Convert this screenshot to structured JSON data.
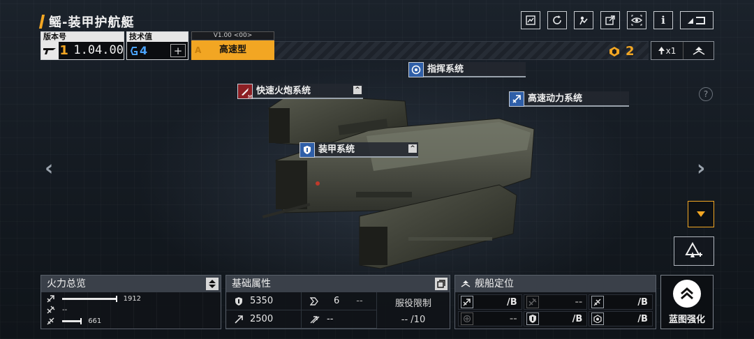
{
  "header": {
    "title": "鳐-装甲护航艇",
    "version": {
      "label": "版本号",
      "tier": "1",
      "value": "1.04.00"
    },
    "tech": {
      "label": "技术值",
      "value": "4",
      "add_symbol": "+"
    },
    "type": {
      "version_tag": "V1.00 <00>",
      "grade": "A",
      "value": "高速型"
    },
    "currency": {
      "value": "2"
    },
    "multiplier": {
      "value": "x1"
    },
    "toolbar_icons": [
      "blueprint-icon",
      "refresh-icon",
      "customize-icon",
      "share-icon",
      "view-icon",
      "info-icon",
      "return-icon"
    ],
    "info_label": "i"
  },
  "systems": [
    {
      "id": "cannon",
      "label": "快速火炮系统",
      "badge": "M",
      "collapse": "^"
    },
    {
      "id": "command",
      "label": "指挥系统"
    },
    {
      "id": "power",
      "label": "高速动力系统"
    },
    {
      "id": "armor",
      "label": "装甲系统",
      "collapse": "^"
    }
  ],
  "nav": {
    "prev": "‹",
    "next": "›",
    "help": "?"
  },
  "panels": {
    "firepower": {
      "title": "火力总览",
      "rows": [
        {
          "icon": "anti-ship-icon",
          "value": "1912",
          "fraction": 0.97
        },
        {
          "icon": "anti-air-icon",
          "value": "--",
          "fraction": 0
        },
        {
          "icon": "siege-icon",
          "value": "661",
          "fraction": 0.34
        }
      ]
    },
    "base": {
      "title": "基础属性",
      "hp": "5350",
      "armor": "6",
      "armor_extra": "--",
      "speed": "2500",
      "evasion": "--",
      "limit_label": "服役限制",
      "limit_value": "-- /10"
    },
    "position": {
      "title": "舰船定位",
      "cells": [
        {
          "icon": "anti-ship-icon",
          "value": "/B",
          "dim": false
        },
        {
          "icon": "anti-air-icon",
          "value": "--",
          "dim": true
        },
        {
          "icon": "siege-icon",
          "value": "/B",
          "dim": false
        },
        {
          "icon": "support-icon",
          "value": "--",
          "dim": true
        },
        {
          "icon": "armor-icon",
          "value": "/B",
          "dim": false
        },
        {
          "icon": "tactics-icon",
          "value": "/B",
          "dim": false
        }
      ]
    }
  },
  "enhance": {
    "label": "蓝图强化"
  },
  "colors": {
    "accent": "#f2a623",
    "tech_blue": "#4aa3ff",
    "panel_bg": "#101318"
  }
}
